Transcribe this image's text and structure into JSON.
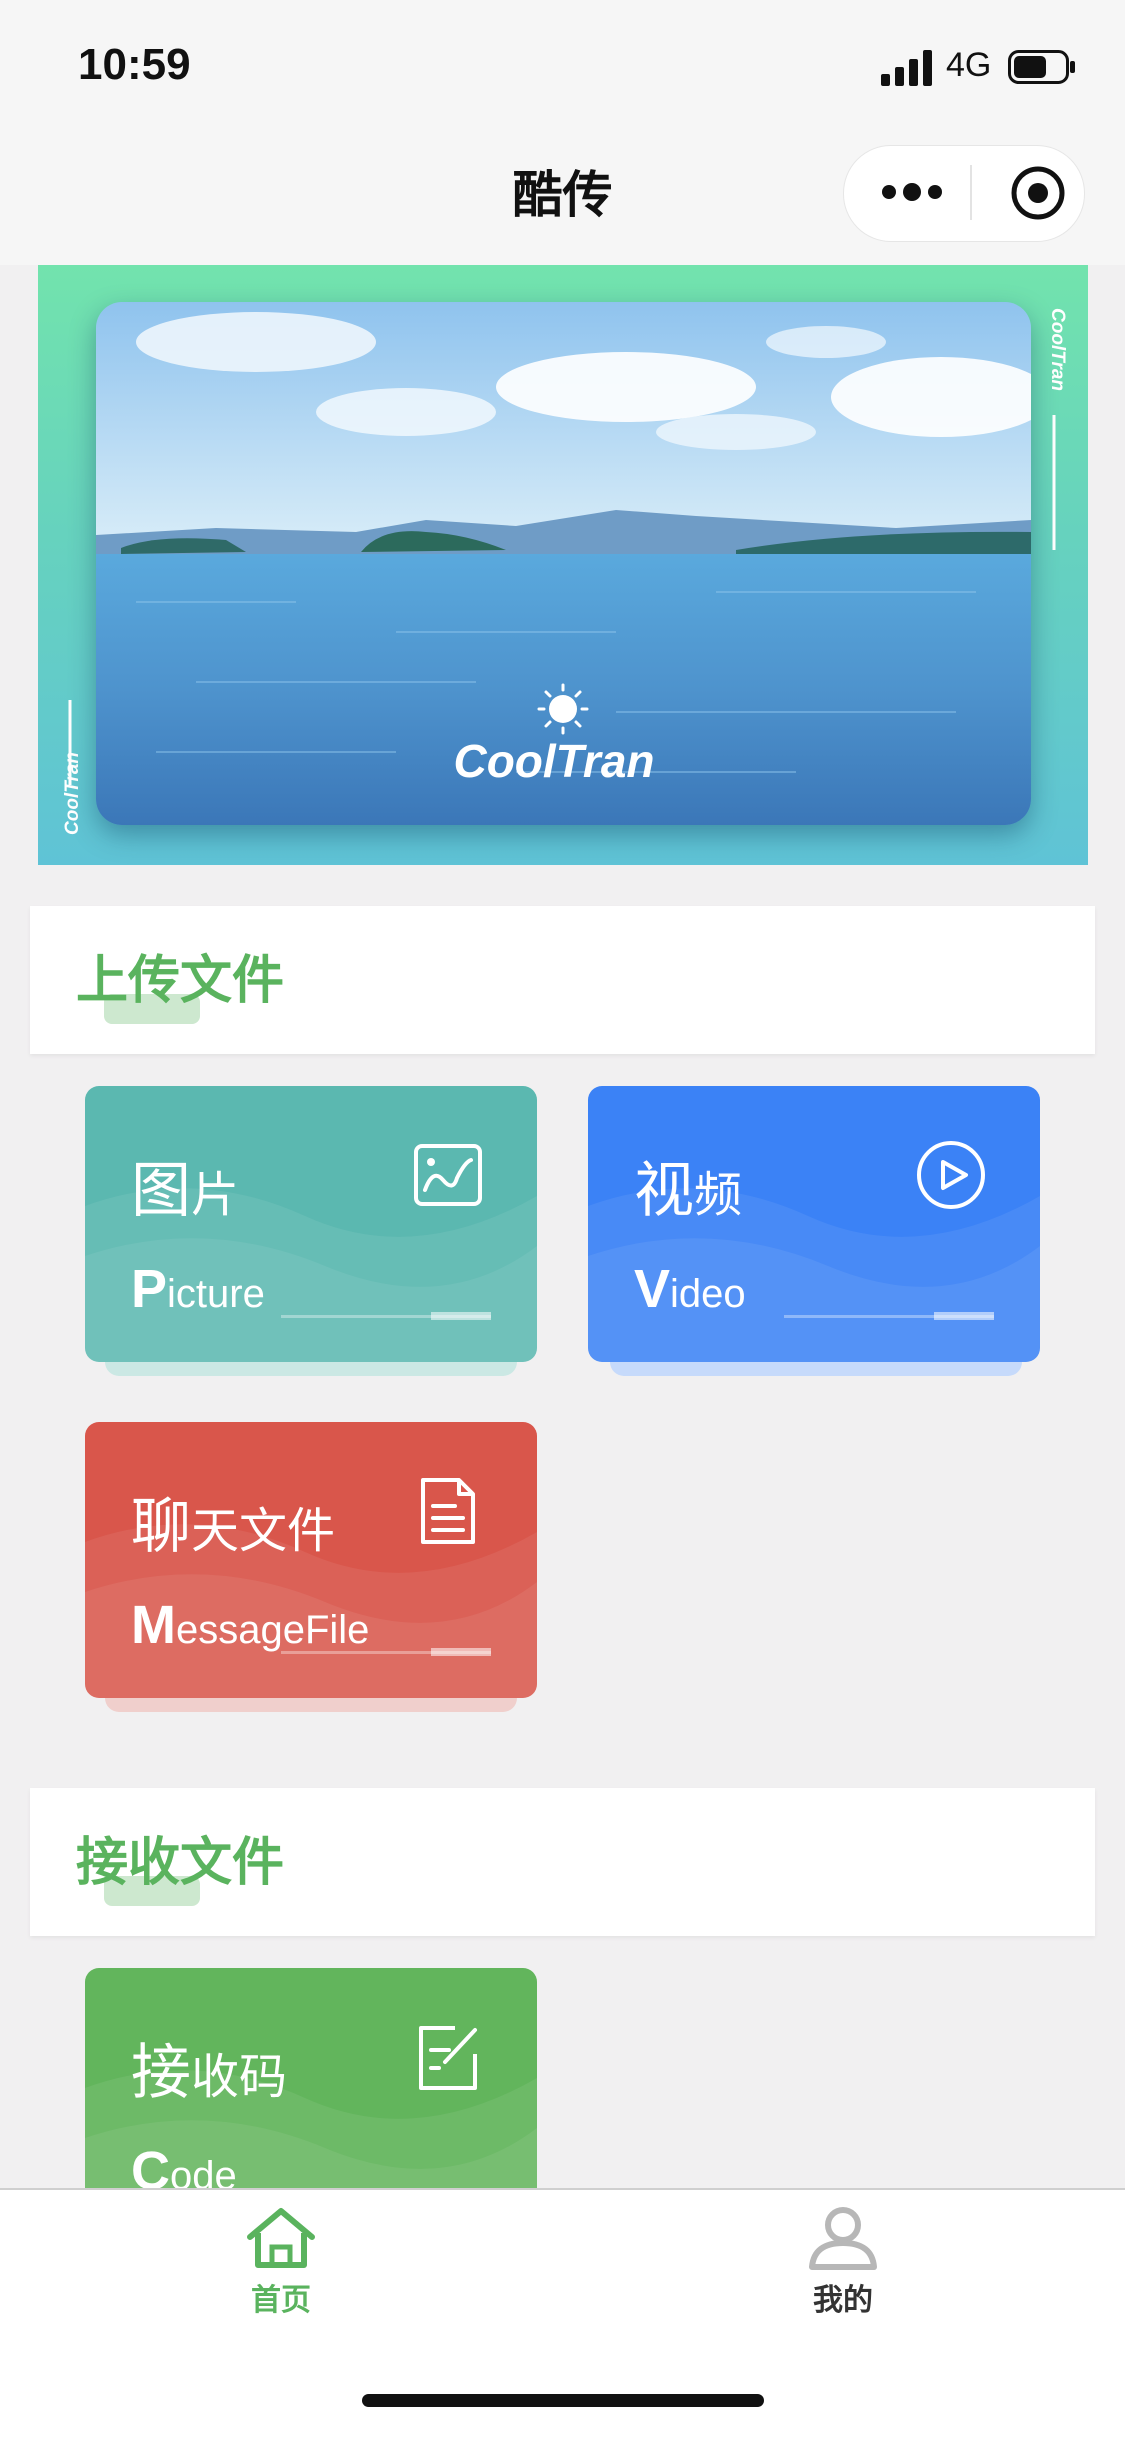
{
  "status_bar": {
    "time": "10:59",
    "network": "4G"
  },
  "nav": {
    "title": "酷传"
  },
  "banner": {
    "brand": "CoolTran",
    "side_text": "CoolTran"
  },
  "upload_section": {
    "title": "上传文件",
    "cards": [
      {
        "zh_main": "图",
        "zh_rest": "片",
        "en_initial": "P",
        "en_rest": "icture",
        "icon": "image-icon",
        "color": "#5bb8b0"
      },
      {
        "zh_main": "视",
        "zh_rest": "频",
        "en_initial": "V",
        "en_rest": "ideo",
        "icon": "play-circle-icon",
        "color": "#3b82f6"
      },
      {
        "zh_main": "聊",
        "zh_rest": "天文件",
        "en_initial": "M",
        "en_rest": "essageFile",
        "icon": "document-icon",
        "color": "#d9564b"
      }
    ]
  },
  "receive_section": {
    "title": "接收文件",
    "cards": [
      {
        "zh_main": "接",
        "zh_rest": "收码",
        "en_initial": "C",
        "en_rest": "ode",
        "icon": "edit-icon",
        "color": "#62b55c"
      }
    ]
  },
  "tabbar": {
    "items": [
      {
        "label": "首页",
        "icon": "home-icon",
        "active": true,
        "color": "#5ab35e"
      },
      {
        "label": "我的",
        "icon": "user-icon",
        "active": false,
        "color": "#333333"
      }
    ]
  }
}
